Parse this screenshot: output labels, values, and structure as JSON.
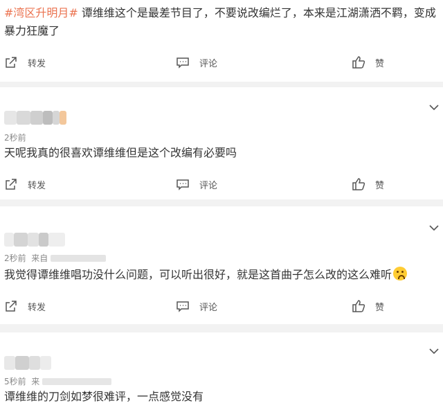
{
  "post1": {
    "hashtag": "#湾区升明月#",
    "text_line1": " 谭维维这个是最差节目了，不要说改编烂了，本来是江湖潇洒不羁，变成",
    "text_line2": "暴力狂魔了",
    "share_label": "转发",
    "comment_label": "评论",
    "like_label": "赞"
  },
  "comments": [
    {
      "time": "2秒前",
      "source": "",
      "text": "天呢我真的很喜欢谭维维但是这个改编有必要吗",
      "share_label": "转发",
      "comment_label": "评论",
      "like_label": "赞"
    },
    {
      "time": "2秒前",
      "source": "来自",
      "text": "我觉得谭维维唱功没什么问题，可以听出很好，就是这首曲子怎么改的这么难听",
      "share_label": "转发",
      "comment_label": "评论",
      "like_label": "赞"
    },
    {
      "time": "5秒前",
      "source": "来",
      "text": "谭维维的刀剑如梦很难评，一点感觉没有"
    }
  ],
  "colors": {
    "hashtag": "#eb7350",
    "separator": "#f2f2f2",
    "meta_text": "#888888"
  },
  "icons": [
    "share-icon",
    "comment-icon",
    "like-icon",
    "chevron-down-icon",
    "crying-emoji-icon"
  ]
}
